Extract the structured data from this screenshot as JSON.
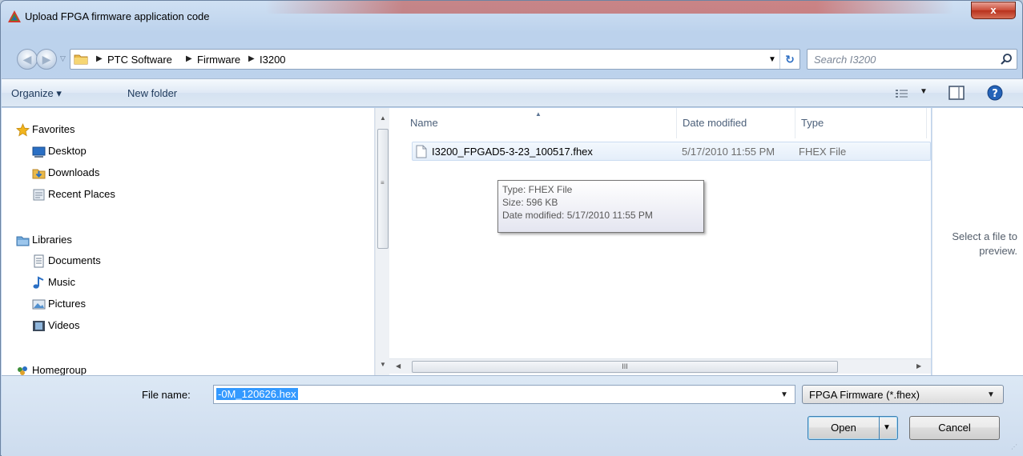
{
  "window": {
    "title": "Upload FPGA firmware application code",
    "close_label": "x"
  },
  "address": {
    "crumbs": [
      "PTC Software",
      "Firmware",
      "I3200"
    ]
  },
  "search": {
    "placeholder": "Search I3200"
  },
  "toolbar": {
    "organize_label": "Organize ▾",
    "new_folder_label": "New folder"
  },
  "nav": {
    "favorites": {
      "label": "Favorites",
      "items": [
        "Desktop",
        "Downloads",
        "Recent Places"
      ]
    },
    "libraries": {
      "label": "Libraries",
      "items": [
        "Documents",
        "Music",
        "Pictures",
        "Videos"
      ]
    },
    "homegroup": {
      "label": "Homegroup"
    }
  },
  "file_list": {
    "columns": {
      "name": "Name",
      "date": "Date modified",
      "type": "Type"
    },
    "files": [
      {
        "name": "I3200_FPGAD5-3-23_100517.fhex",
        "date": "5/17/2010 11:55 PM",
        "type": "FHEX File"
      }
    ],
    "scroll_label": "III"
  },
  "tooltip": {
    "type": "Type: FHEX File",
    "size": "Size: 596 KB",
    "date": "Date modified: 5/17/2010 11:55 PM"
  },
  "preview": {
    "text_line1": "Select a file to",
    "text_line2": "preview."
  },
  "bottom": {
    "filename_label": "File name:",
    "filename_value": "-0M_120626.hex",
    "filetype_value": "FPGA Firmware (*.fhex)",
    "open_label": "Open",
    "cancel_label": "Cancel"
  },
  "colors": {
    "selection": "#3399ff",
    "frame": "#bcd2ec",
    "close": "#c94a36"
  }
}
